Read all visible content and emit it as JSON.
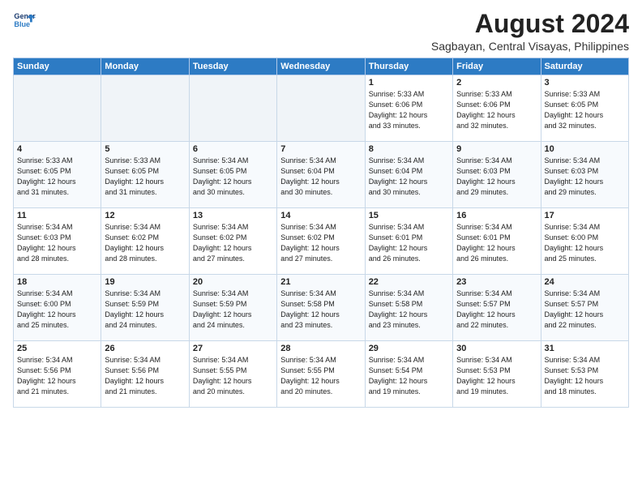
{
  "logo": {
    "line1": "General",
    "line2": "Blue"
  },
  "title": "August 2024",
  "subtitle": "Sagbayan, Central Visayas, Philippines",
  "weekdays": [
    "Sunday",
    "Monday",
    "Tuesday",
    "Wednesday",
    "Thursday",
    "Friday",
    "Saturday"
  ],
  "weeks": [
    [
      {
        "day": "",
        "info": ""
      },
      {
        "day": "",
        "info": ""
      },
      {
        "day": "",
        "info": ""
      },
      {
        "day": "",
        "info": ""
      },
      {
        "day": "1",
        "info": "Sunrise: 5:33 AM\nSunset: 6:06 PM\nDaylight: 12 hours\nand 33 minutes."
      },
      {
        "day": "2",
        "info": "Sunrise: 5:33 AM\nSunset: 6:06 PM\nDaylight: 12 hours\nand 32 minutes."
      },
      {
        "day": "3",
        "info": "Sunrise: 5:33 AM\nSunset: 6:05 PM\nDaylight: 12 hours\nand 32 minutes."
      }
    ],
    [
      {
        "day": "4",
        "info": "Sunrise: 5:33 AM\nSunset: 6:05 PM\nDaylight: 12 hours\nand 31 minutes."
      },
      {
        "day": "5",
        "info": "Sunrise: 5:33 AM\nSunset: 6:05 PM\nDaylight: 12 hours\nand 31 minutes."
      },
      {
        "day": "6",
        "info": "Sunrise: 5:34 AM\nSunset: 6:05 PM\nDaylight: 12 hours\nand 30 minutes."
      },
      {
        "day": "7",
        "info": "Sunrise: 5:34 AM\nSunset: 6:04 PM\nDaylight: 12 hours\nand 30 minutes."
      },
      {
        "day": "8",
        "info": "Sunrise: 5:34 AM\nSunset: 6:04 PM\nDaylight: 12 hours\nand 30 minutes."
      },
      {
        "day": "9",
        "info": "Sunrise: 5:34 AM\nSunset: 6:03 PM\nDaylight: 12 hours\nand 29 minutes."
      },
      {
        "day": "10",
        "info": "Sunrise: 5:34 AM\nSunset: 6:03 PM\nDaylight: 12 hours\nand 29 minutes."
      }
    ],
    [
      {
        "day": "11",
        "info": "Sunrise: 5:34 AM\nSunset: 6:03 PM\nDaylight: 12 hours\nand 28 minutes."
      },
      {
        "day": "12",
        "info": "Sunrise: 5:34 AM\nSunset: 6:02 PM\nDaylight: 12 hours\nand 28 minutes."
      },
      {
        "day": "13",
        "info": "Sunrise: 5:34 AM\nSunset: 6:02 PM\nDaylight: 12 hours\nand 27 minutes."
      },
      {
        "day": "14",
        "info": "Sunrise: 5:34 AM\nSunset: 6:02 PM\nDaylight: 12 hours\nand 27 minutes."
      },
      {
        "day": "15",
        "info": "Sunrise: 5:34 AM\nSunset: 6:01 PM\nDaylight: 12 hours\nand 26 minutes."
      },
      {
        "day": "16",
        "info": "Sunrise: 5:34 AM\nSunset: 6:01 PM\nDaylight: 12 hours\nand 26 minutes."
      },
      {
        "day": "17",
        "info": "Sunrise: 5:34 AM\nSunset: 6:00 PM\nDaylight: 12 hours\nand 25 minutes."
      }
    ],
    [
      {
        "day": "18",
        "info": "Sunrise: 5:34 AM\nSunset: 6:00 PM\nDaylight: 12 hours\nand 25 minutes."
      },
      {
        "day": "19",
        "info": "Sunrise: 5:34 AM\nSunset: 5:59 PM\nDaylight: 12 hours\nand 24 minutes."
      },
      {
        "day": "20",
        "info": "Sunrise: 5:34 AM\nSunset: 5:59 PM\nDaylight: 12 hours\nand 24 minutes."
      },
      {
        "day": "21",
        "info": "Sunrise: 5:34 AM\nSunset: 5:58 PM\nDaylight: 12 hours\nand 23 minutes."
      },
      {
        "day": "22",
        "info": "Sunrise: 5:34 AM\nSunset: 5:58 PM\nDaylight: 12 hours\nand 23 minutes."
      },
      {
        "day": "23",
        "info": "Sunrise: 5:34 AM\nSunset: 5:57 PM\nDaylight: 12 hours\nand 22 minutes."
      },
      {
        "day": "24",
        "info": "Sunrise: 5:34 AM\nSunset: 5:57 PM\nDaylight: 12 hours\nand 22 minutes."
      }
    ],
    [
      {
        "day": "25",
        "info": "Sunrise: 5:34 AM\nSunset: 5:56 PM\nDaylight: 12 hours\nand 21 minutes."
      },
      {
        "day": "26",
        "info": "Sunrise: 5:34 AM\nSunset: 5:56 PM\nDaylight: 12 hours\nand 21 minutes."
      },
      {
        "day": "27",
        "info": "Sunrise: 5:34 AM\nSunset: 5:55 PM\nDaylight: 12 hours\nand 20 minutes."
      },
      {
        "day": "28",
        "info": "Sunrise: 5:34 AM\nSunset: 5:55 PM\nDaylight: 12 hours\nand 20 minutes."
      },
      {
        "day": "29",
        "info": "Sunrise: 5:34 AM\nSunset: 5:54 PM\nDaylight: 12 hours\nand 19 minutes."
      },
      {
        "day": "30",
        "info": "Sunrise: 5:34 AM\nSunset: 5:53 PM\nDaylight: 12 hours\nand 19 minutes."
      },
      {
        "day": "31",
        "info": "Sunrise: 5:34 AM\nSunset: 5:53 PM\nDaylight: 12 hours\nand 18 minutes."
      }
    ]
  ]
}
